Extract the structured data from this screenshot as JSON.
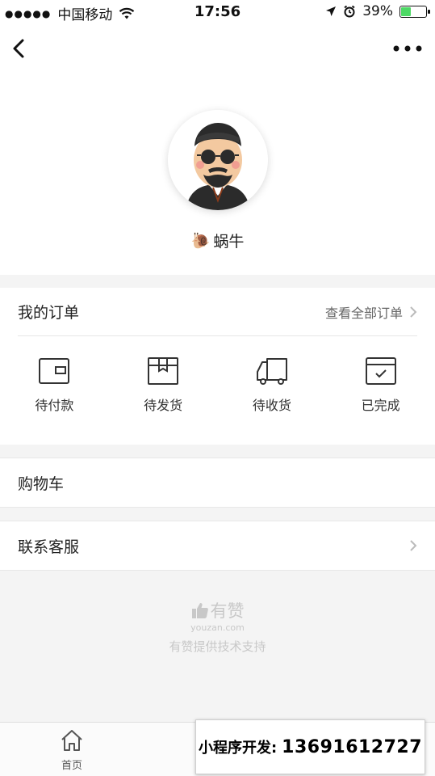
{
  "status_bar": {
    "signal_dots": "●●●●●",
    "carrier": "中国移动",
    "time": "17:56",
    "battery_percent": "39%",
    "battery_level": 0.39,
    "icons": [
      "wifi-icon",
      "location-arrow-icon",
      "alarm-icon",
      "battery-icon"
    ]
  },
  "navbar": {
    "icons": [
      "back-chevron-icon",
      "more-dots-icon"
    ]
  },
  "profile": {
    "nickname": "蜗牛",
    "emoji": "🐌"
  },
  "orders": {
    "title": "我的订单",
    "view_all": "查看全部订单",
    "items": [
      {
        "label": "待付款",
        "icon": "wallet-icon"
      },
      {
        "label": "待发货",
        "icon": "package-box-icon"
      },
      {
        "label": "待收货",
        "icon": "delivery-truck-icon"
      },
      {
        "label": "已完成",
        "icon": "completed-check-icon"
      }
    ]
  },
  "cart": {
    "label": "购物车"
  },
  "service": {
    "label": "联系客服"
  },
  "brand": {
    "name": "有赞",
    "domain": "youzan.com",
    "support": "有赞提供技术支持"
  },
  "tabbar": {
    "home_label": "首页"
  },
  "promo": {
    "label": "小程序开发:",
    "phone": "13691612727"
  },
  "colors": {
    "battery_fill": "#4cd964",
    "background": "#f4f4f4",
    "muted": "#c8c8c8"
  }
}
